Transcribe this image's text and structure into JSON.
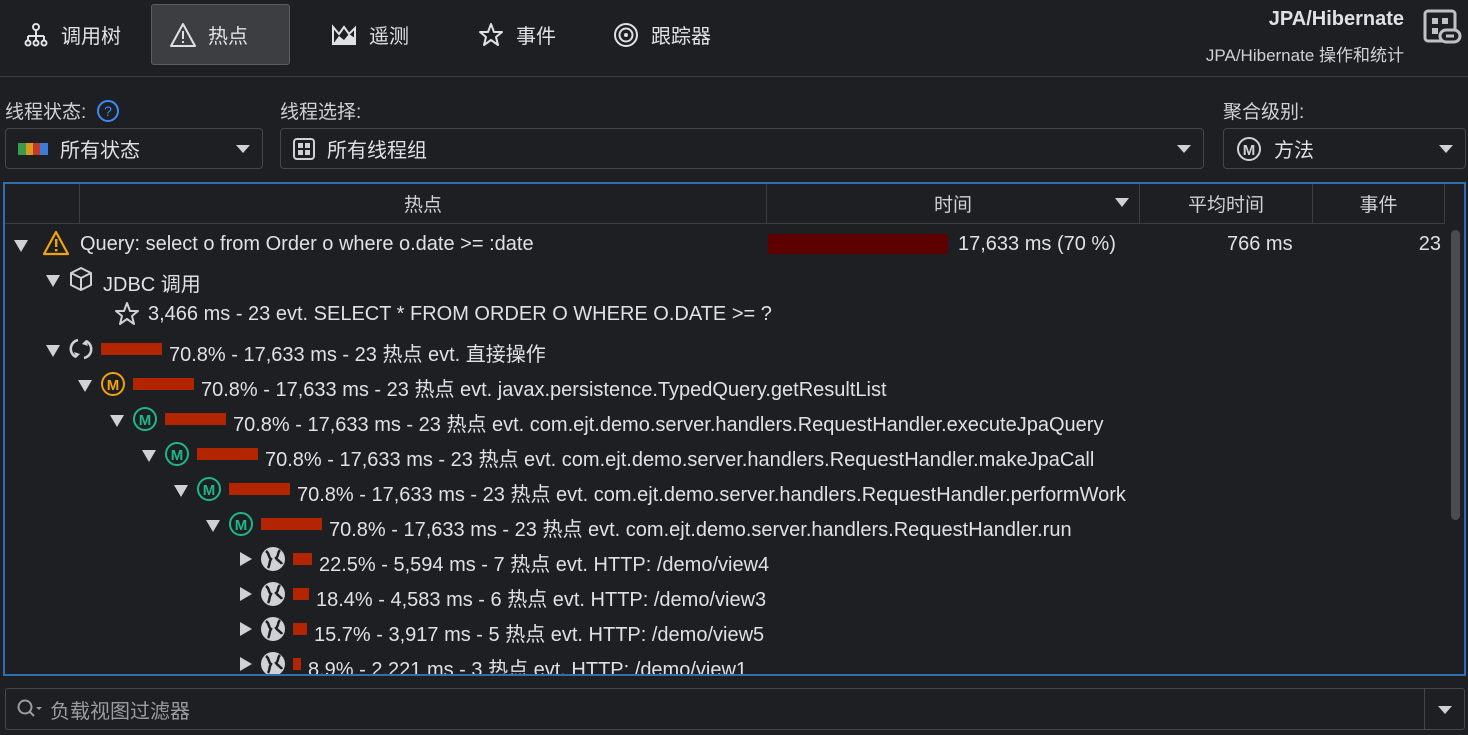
{
  "tabs": [
    {
      "label": "调用树",
      "icon": "call-tree-icon"
    },
    {
      "label": "热点",
      "icon": "warning-icon",
      "active": true
    },
    {
      "label": "遥测",
      "icon": "telemetry-icon"
    },
    {
      "label": "事件",
      "icon": "star-icon"
    },
    {
      "label": "跟踪器",
      "icon": "tracker-icon"
    }
  ],
  "header": {
    "title": "JPA/Hibernate",
    "subtitle": "JPA/Hibernate 操作和统计"
  },
  "filters": {
    "thread_state_label": "线程状态:",
    "thread_state_value": "所有状态",
    "thread_select_label": "线程选择:",
    "thread_select_value": "所有线程组",
    "aggregation_label": "聚合级别:",
    "aggregation_value": "方法"
  },
  "columns": {
    "hotspot": "热点",
    "time": "时间",
    "avg_time": "平均时间",
    "events": "事件"
  },
  "top_row": {
    "label": "Query: select o from Order o where o.date >= :date",
    "time": "17,633 ms (70 %)",
    "time_pct": 70,
    "avg": "766 ms",
    "events": "23"
  },
  "rows": [
    {
      "level": 1,
      "expand": "down",
      "icon": "package",
      "text": "JDBC 调用"
    },
    {
      "level": 2,
      "expand": "none",
      "icon": "star",
      "text": "3,466 ms - 23 evt. SELECT * FROM ORDER O WHERE O.DATE >= ?"
    },
    {
      "level": 1,
      "expand": "down",
      "icon": "refresh",
      "pct": 70.8,
      "text": "70.8% - 17,633 ms - 23 热点 evt. 直接操作"
    },
    {
      "level": 2,
      "expand": "down",
      "icon": "method-orange",
      "pct": 70.8,
      "text": "70.8% - 17,633 ms - 23 热点 evt. javax.persistence.TypedQuery.getResultList"
    },
    {
      "level": 3,
      "expand": "down",
      "icon": "method-green",
      "pct": 70.8,
      "text": "70.8% - 17,633 ms - 23 热点 evt. com.ejt.demo.server.handlers.RequestHandler.executeJpaQuery"
    },
    {
      "level": 4,
      "expand": "down",
      "icon": "method-green",
      "pct": 70.8,
      "text": "70.8% - 17,633 ms - 23 热点 evt. com.ejt.demo.server.handlers.RequestHandler.makeJpaCall"
    },
    {
      "level": 5,
      "expand": "down",
      "icon": "method-green",
      "pct": 70.8,
      "text": "70.8% - 17,633 ms - 23 热点 evt. com.ejt.demo.server.handlers.RequestHandler.performWork"
    },
    {
      "level": 6,
      "expand": "down",
      "icon": "method-green",
      "pct": 70.8,
      "text": "70.8% - 17,633 ms - 23 热点 evt. com.ejt.demo.server.handlers.RequestHandler.run"
    },
    {
      "level": 7,
      "expand": "right",
      "icon": "globe",
      "pct": 22.5,
      "text": "22.5% - 5,594 ms - 7 热点 evt. HTTP: /demo/view4"
    },
    {
      "level": 7,
      "expand": "right",
      "icon": "globe",
      "pct": 18.4,
      "text": "18.4% - 4,583 ms - 6 热点 evt. HTTP: /demo/view3"
    },
    {
      "level": 7,
      "expand": "right",
      "icon": "globe",
      "pct": 15.7,
      "text": "15.7% - 3,917 ms - 5 热点 evt. HTTP: /demo/view5"
    },
    {
      "level": 7,
      "expand": "right",
      "icon": "globe",
      "pct": 8.9,
      "text": "8.9% - 2,221 ms - 3 热点 evt. HTTP: /demo/view1"
    }
  ],
  "filter": {
    "placeholder": "负载视图过滤器"
  },
  "colors": {
    "accent": "#2f6fb0",
    "bar": "#b32500",
    "top_bar": "#5c0000",
    "warning": "#f0a30a",
    "method_green": "#1fb885",
    "method_orange": "#f0a30a"
  }
}
